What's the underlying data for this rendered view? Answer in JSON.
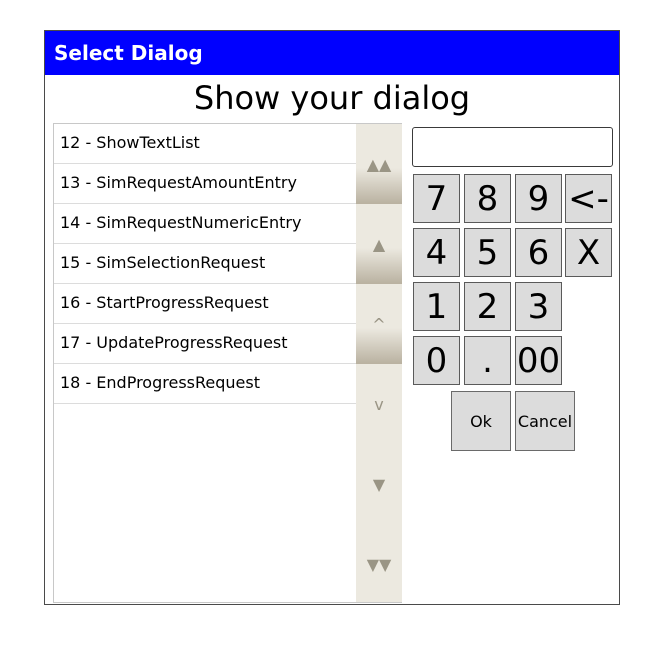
{
  "dialog": {
    "title": "Select Dialog",
    "heading": "Show your dialog",
    "title_bar_color": "#0000ff"
  },
  "list": {
    "items": [
      "12 - ShowTextList",
      "13 - SimRequestAmountEntry",
      "14 - SimRequestNumericEntry",
      "15 - SimSelectionRequest",
      "16 - StartProgressRequest",
      "17 - UpdateProgressRequest",
      "18 - EndProgressRequest"
    ]
  },
  "scrollbar": {
    "page_up_glyph": "▲▲",
    "line_up_glyph": "▲",
    "small_up_glyph": "^",
    "small_down_glyph": "v",
    "line_down_glyph": "▼",
    "page_down_glyph": "▼▼"
  },
  "numpad": {
    "display_value": "",
    "keys": [
      "7",
      "8",
      "9",
      "<-",
      "4",
      "5",
      "6",
      "X",
      "1",
      "2",
      "3",
      "0",
      ".",
      "00"
    ]
  },
  "actions": {
    "ok_label": "Ok",
    "cancel_label": "Cancel"
  }
}
